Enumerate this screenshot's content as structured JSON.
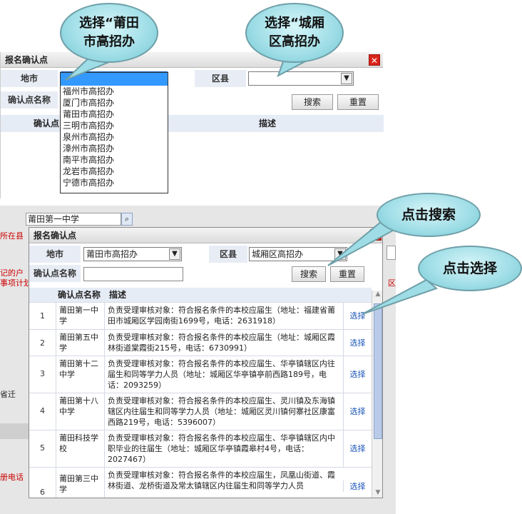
{
  "callouts": {
    "select_city": "选择“莆田市高招办",
    "select_district": "选择“城厢区高招办",
    "click_search": "点击搜索",
    "click_select": "点击选择"
  },
  "top_dialog": {
    "title": "报名确认点",
    "city_label": "地市",
    "district_label": "区县",
    "point_name_label": "确认点名称",
    "search_button": "搜索",
    "reset_button": "重置",
    "col_point": "确认点",
    "col_desc": "描述",
    "city_options": [
      "福州市高招办",
      "厦门市高招办",
      "莆田市高招办",
      "三明市高招办",
      "泉州市高招办",
      "漳州市高招办",
      "南平市高招办",
      "龙岩市高招办",
      "宁德市高招办"
    ]
  },
  "background_page": {
    "search_value": "莆田第一中学",
    "side_text_1": "所在县",
    "side_text_2": "记的户",
    "side_text_3": "事项计划",
    "side_text_4": "省迁",
    "side_text_5": "册电话",
    "right_text": "区"
  },
  "bottom_dialog": {
    "title": "报名确认点",
    "city_label": "地市",
    "city_value": "莆田市高招办",
    "district_label": "区县",
    "district_value": "城厢区高招办",
    "point_name_label": "确认点名称",
    "search_button": "搜索",
    "reset_button": "重置",
    "col_name": "确认点名称",
    "col_desc": "描述",
    "rows": [
      {
        "num": "1",
        "name": "莆田第一中学",
        "desc": "负责受理审核对象：符合报名条件的本校应届生（地址：福建省莆田市城厢区学园南街1699号，电话：2631918）",
        "action": "选择"
      },
      {
        "num": "2",
        "name": "莆田第五中学",
        "desc": "负责受理审核对象：符合报名条件的本校应届生（地址：城厢区霞林街道棠霞街215号，电话：6730991）",
        "action": "选择"
      },
      {
        "num": "3",
        "name": "莆田第十二中学",
        "desc": "负责受理审核对象：符合报名条件的本校应届生、华亭镇辖区内往届生和同等学力人员（地址：城厢区华亭镇亭前西路189号，电话：2093259）",
        "action": "选择"
      },
      {
        "num": "4",
        "name": "莆田第十八中学",
        "desc": "负责受理审核对象：符合报名条件的本校应届生、灵川镇及东海镇辖区内往届生和同等学力人员（地址：城厢区灵川镇何寨社区康富西路219号，电话：5396007）",
        "action": "选择"
      },
      {
        "num": "5",
        "name": "莆田科技学校",
        "desc": "负责受理审核对象：符合报名条件的本校应届生、华亭镇辖区内中职毕业的往届生（地址：城厢区华亭镇霞皋村4号，电话：2027467）",
        "action": "选择"
      },
      {
        "num": "6",
        "name": "莆田第三中学",
        "desc": "负责受理审核对象：符合报名条件的本校应届生，凤凰山街道、霞林街道、龙桥街道及常太镇辖区内往届生和同等学力人员",
        "action": "选择"
      }
    ]
  }
}
